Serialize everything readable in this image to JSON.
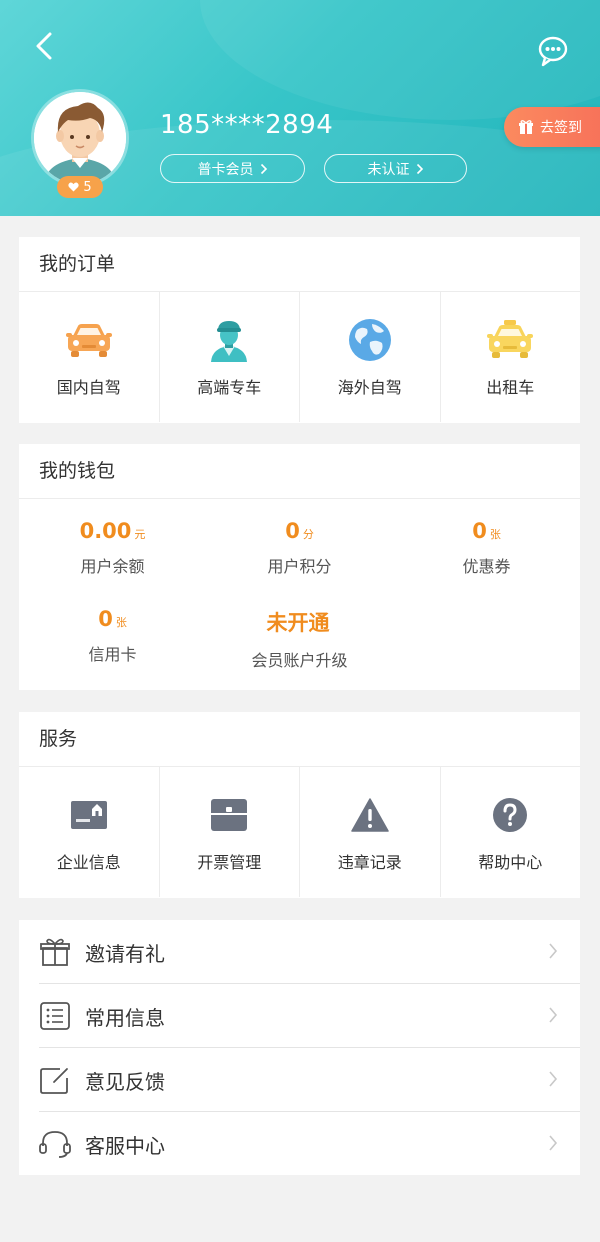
{
  "header": {
    "phone": "185****2894",
    "like_count": "5",
    "membership_label": "普卡会员",
    "verify_label": "未认证",
    "checkin_label": "去签到",
    "back_icon": "chevron-left-icon",
    "message_icon": "chat-bubble-icon",
    "colors": {
      "gradient_start": "#5fd6d8",
      "gradient_end": "#22b4bb",
      "checkin": "#f7725a",
      "badge": "#f7a24a"
    }
  },
  "orders": {
    "title": "我的订单",
    "items": [
      {
        "label": "国内自驾",
        "icon": "car-icon"
      },
      {
        "label": "高端专车",
        "icon": "chauffeur-icon"
      },
      {
        "label": "海外自驾",
        "icon": "globe-icon"
      },
      {
        "label": "出租车",
        "icon": "taxi-icon"
      }
    ]
  },
  "wallet": {
    "title": "我的钱包",
    "accent": "#f08c1e",
    "items": [
      {
        "value": "0.00",
        "unit": "元",
        "label": "用户余额"
      },
      {
        "value": "0",
        "unit": "分",
        "label": "用户积分"
      },
      {
        "value": "0",
        "unit": "张",
        "label": "优惠券"
      },
      {
        "value": "0",
        "unit": "张",
        "label": "信用卡"
      },
      {
        "value": "未开通",
        "unit": "",
        "label": "会员账户升级"
      }
    ]
  },
  "services": {
    "title": "服务",
    "items": [
      {
        "label": "企业信息",
        "icon": "company-card-icon"
      },
      {
        "label": "开票管理",
        "icon": "invoice-icon"
      },
      {
        "label": "违章记录",
        "icon": "warning-icon"
      },
      {
        "label": "帮助中心",
        "icon": "help-icon"
      }
    ]
  },
  "menu": [
    {
      "label": "邀请有礼",
      "icon": "gift-icon"
    },
    {
      "label": "常用信息",
      "icon": "list-icon"
    },
    {
      "label": "意见反馈",
      "icon": "edit-icon"
    },
    {
      "label": "客服中心",
      "icon": "headset-icon"
    }
  ]
}
